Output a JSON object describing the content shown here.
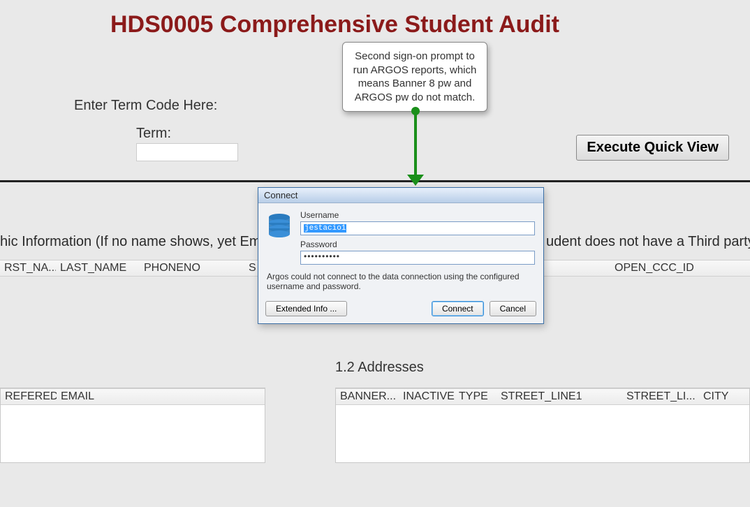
{
  "title": "HDS0005 Comprehensive Student Audit",
  "enter_term_label": "Enter Term Code Here:",
  "term_label": "Term:",
  "term_value": "",
  "exec_label": "Execute Quick View",
  "section_info_left": "hic Information (If no name shows, yet Emai",
  "section_info_right": "udent does not have a Third party ID",
  "table1_headers": [
    "RST_NA...",
    "LAST_NAME",
    "PHONENO",
    "S",
    "OPEN_CCC_ID"
  ],
  "addresses_title": "1.2 Addresses",
  "table2_headers": [
    "REFERED",
    "EMAIL"
  ],
  "table3_headers": [
    "BANNER...",
    "INACTIVE",
    "TYPE",
    "STREET_LINE1",
    "STREET_LI...",
    "CITY"
  ],
  "callout_text": "Second sign-on prompt to run ARGOS reports, which means Banner 8 pw and ARGOS pw do not match.",
  "dialog": {
    "title": "Connect",
    "username_label": "Username",
    "username_value": "jestacio1",
    "password_label": "Password",
    "password_value": "••••••••••",
    "error_msg": "Argos could not connect to the data connection using the configured username and password.",
    "extended_label": "Extended Info ...",
    "connect_label": "Connect",
    "cancel_label": "Cancel"
  }
}
